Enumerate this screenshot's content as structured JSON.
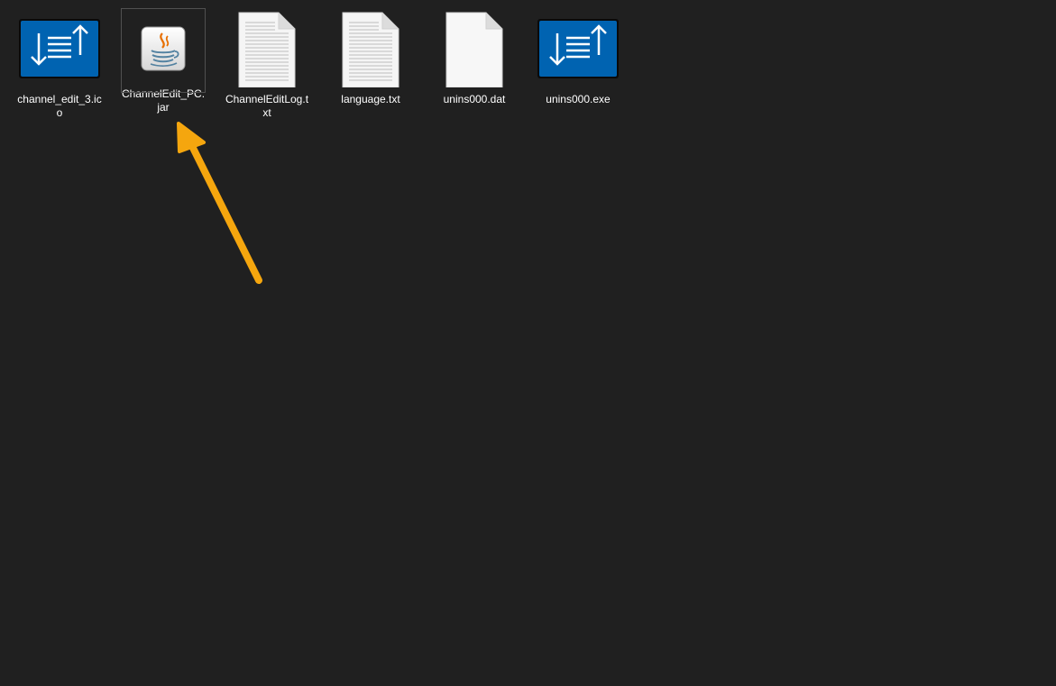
{
  "files": [
    {
      "name": "channel_edit_3.ico",
      "icon": "channel-edit-monitor-icon"
    },
    {
      "name": "ChannelEdit_PC.jar",
      "icon": "java-icon",
      "selected": true
    },
    {
      "name": "ChannelEditLog.txt",
      "icon": "text-document-icon"
    },
    {
      "name": "language.txt",
      "icon": "text-document-icon"
    },
    {
      "name": "unins000.dat",
      "icon": "blank-document-icon"
    },
    {
      "name": "unins000.exe",
      "icon": "channel-edit-monitor-icon"
    }
  ],
  "colors": {
    "background": "#202020",
    "monitor_blue": "#0063b1",
    "arrow": "#f5a60e"
  }
}
